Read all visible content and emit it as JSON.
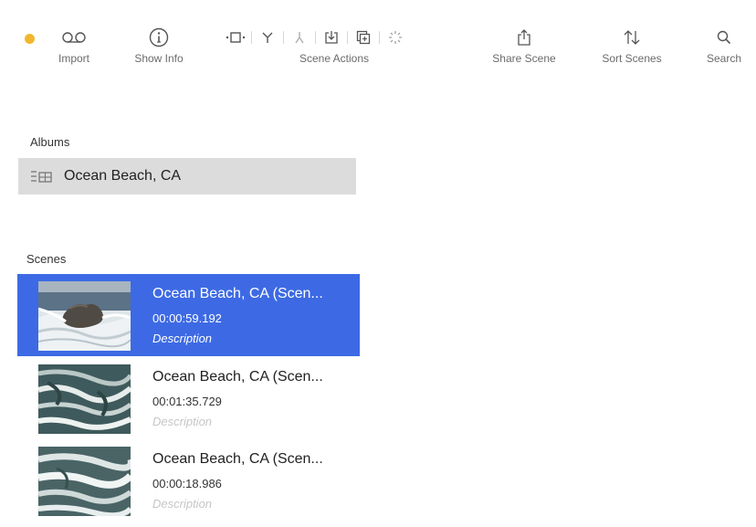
{
  "toolbar": {
    "status_dot_color": "#f2b72f",
    "import_label": "Import",
    "show_info_label": "Show Info",
    "scene_actions_label": "Scene Actions",
    "share_scene_label": "Share Scene",
    "sort_scenes_label": "Sort Scenes",
    "search_label": "Search"
  },
  "albums": {
    "header": "Albums",
    "items": [
      {
        "title": "Ocean Beach, CA"
      }
    ]
  },
  "scenes": {
    "header": "Scenes",
    "items": [
      {
        "title": "Ocean Beach, CA (Scen...",
        "duration": "00:00:59.192",
        "description": "Description",
        "selected": true
      },
      {
        "title": "Ocean Beach, CA (Scen...",
        "duration": "00:01:35.729",
        "description": "Description",
        "selected": false
      },
      {
        "title": "Ocean Beach, CA (Scen...",
        "duration": "00:00:18.986",
        "description": "Description",
        "selected": false
      }
    ]
  },
  "colors": {
    "selection": "#3d6ae4",
    "album_row_bg": "#dcdcdc"
  }
}
